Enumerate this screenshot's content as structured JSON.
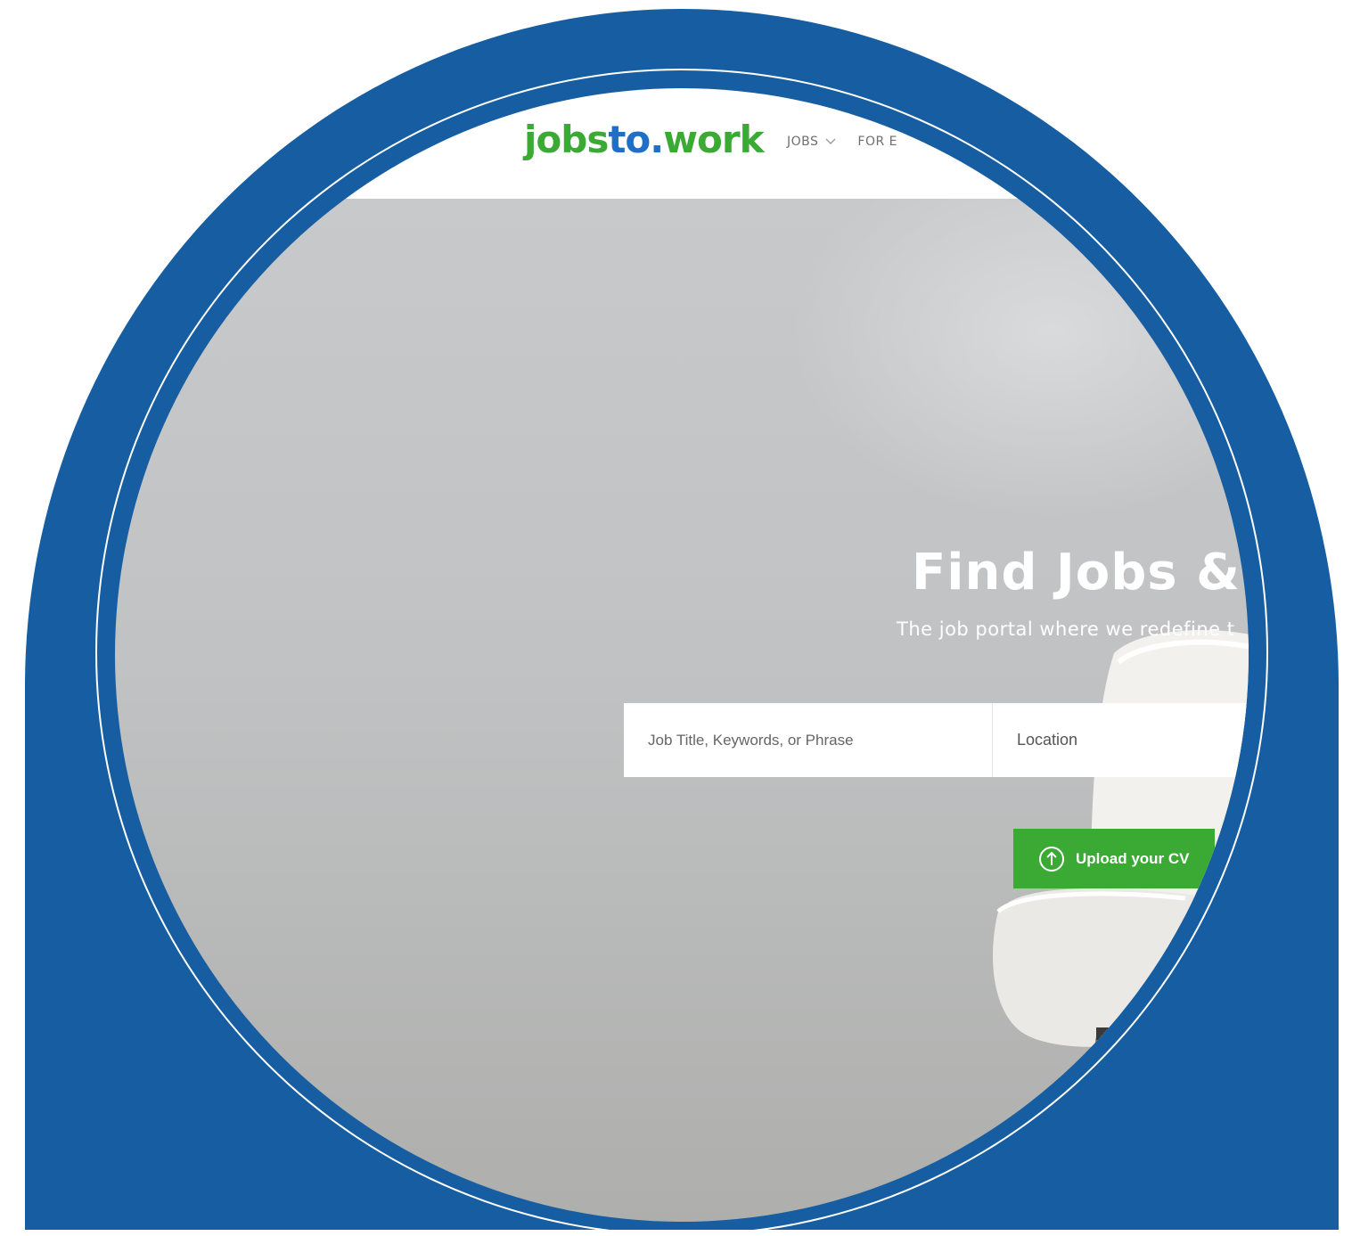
{
  "logo": {
    "part1": "jobs",
    "part2": "to",
    "part3": "work",
    "dot": "."
  },
  "nav": {
    "items": [
      {
        "label": "JOBS",
        "icon": "chevron-down-icon"
      },
      {
        "label": "FOR E"
      }
    ]
  },
  "hero": {
    "title": "Find Jobs & C",
    "subtitle": "The job portal where we redefine t"
  },
  "search": {
    "keywords_placeholder": "Job Title, Keywords, or Phrase",
    "location_placeholder": "Location"
  },
  "upload": {
    "label": "Upload your CV",
    "icon": "upload-arrow-icon"
  },
  "colors": {
    "frame_blue": "#165ea1",
    "brand_green": "#3aaa35",
    "brand_blue": "#1f6fc7"
  }
}
